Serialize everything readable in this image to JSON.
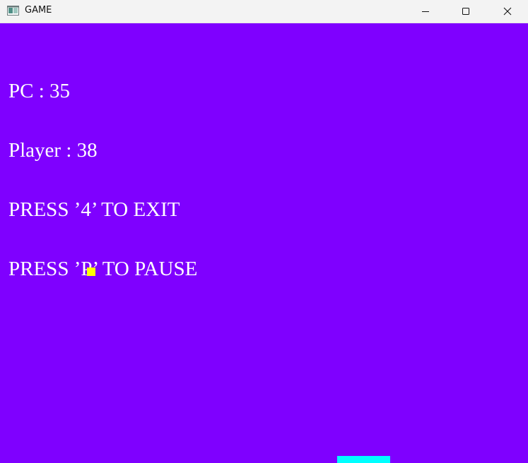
{
  "window": {
    "title": "GAME",
    "app_icon": "game-window-icon",
    "controls": {
      "minimize_icon": "minimize-icon",
      "maximize_icon": "maximize-icon",
      "close_icon": "close-icon"
    }
  },
  "game": {
    "background_color": "#7f00ff",
    "text_color": "#ffffff",
    "ball_color": "#ffff00",
    "paddle_color": "#00ffff",
    "hud": {
      "pc_score": "PC : 35",
      "player_score": "Player : 38",
      "exit_hint": "PRESS ’4’ TO EXIT",
      "pause_hint": "PRESS ’P’ TO PAUSE"
    }
  }
}
